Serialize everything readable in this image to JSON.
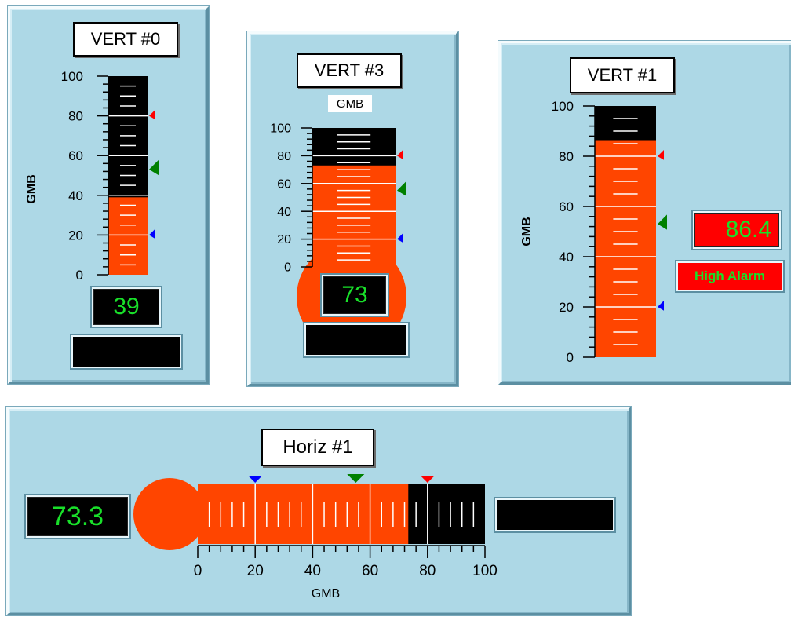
{
  "gauges": {
    "vert0": {
      "title": "VERT #0",
      "unit_label": "GMB",
      "value": 39,
      "readout": "39",
      "high_alarm": 80,
      "setpoint": 53,
      "low_alarm": 20,
      "scale_min": 0,
      "scale_max": 100,
      "ticks": [
        "0",
        "20",
        "40",
        "60",
        "80",
        "100"
      ]
    },
    "vert3": {
      "title": "VERT #3",
      "unit_label": "GMB",
      "value": 73,
      "readout": "73",
      "high_alarm": 80,
      "setpoint": 55,
      "low_alarm": 20,
      "scale_min": 0,
      "scale_max": 100,
      "ticks": [
        "0",
        "20",
        "40",
        "60",
        "80",
        "100"
      ]
    },
    "vert1": {
      "title": "VERT #1",
      "unit_label": "GMB",
      "value": 86.4,
      "readout": "86.4",
      "status": "High Alarm",
      "high_alarm": 80,
      "setpoint": 53,
      "low_alarm": 20,
      "scale_min": 0,
      "scale_max": 100,
      "ticks": [
        "0",
        "20",
        "40",
        "60",
        "80",
        "100"
      ]
    },
    "horiz1": {
      "title": "Horiz #1",
      "unit_label": "GMB",
      "value": 73.3,
      "readout": "73.3",
      "high_alarm": 80,
      "setpoint": 55,
      "low_alarm": 20,
      "scale_min": 0,
      "scale_max": 100,
      "ticks": [
        "0",
        "20",
        "40",
        "60",
        "80",
        "100"
      ]
    }
  },
  "colors": {
    "panel": "#add8e6",
    "fill": "#ff4500",
    "empty": "#000000",
    "readout_text": "#19e02a",
    "high_alarm_marker": "#ff0000",
    "setpoint_marker": "#008000",
    "low_alarm_marker": "#0000ff",
    "alarm_box": "#ff0000"
  }
}
